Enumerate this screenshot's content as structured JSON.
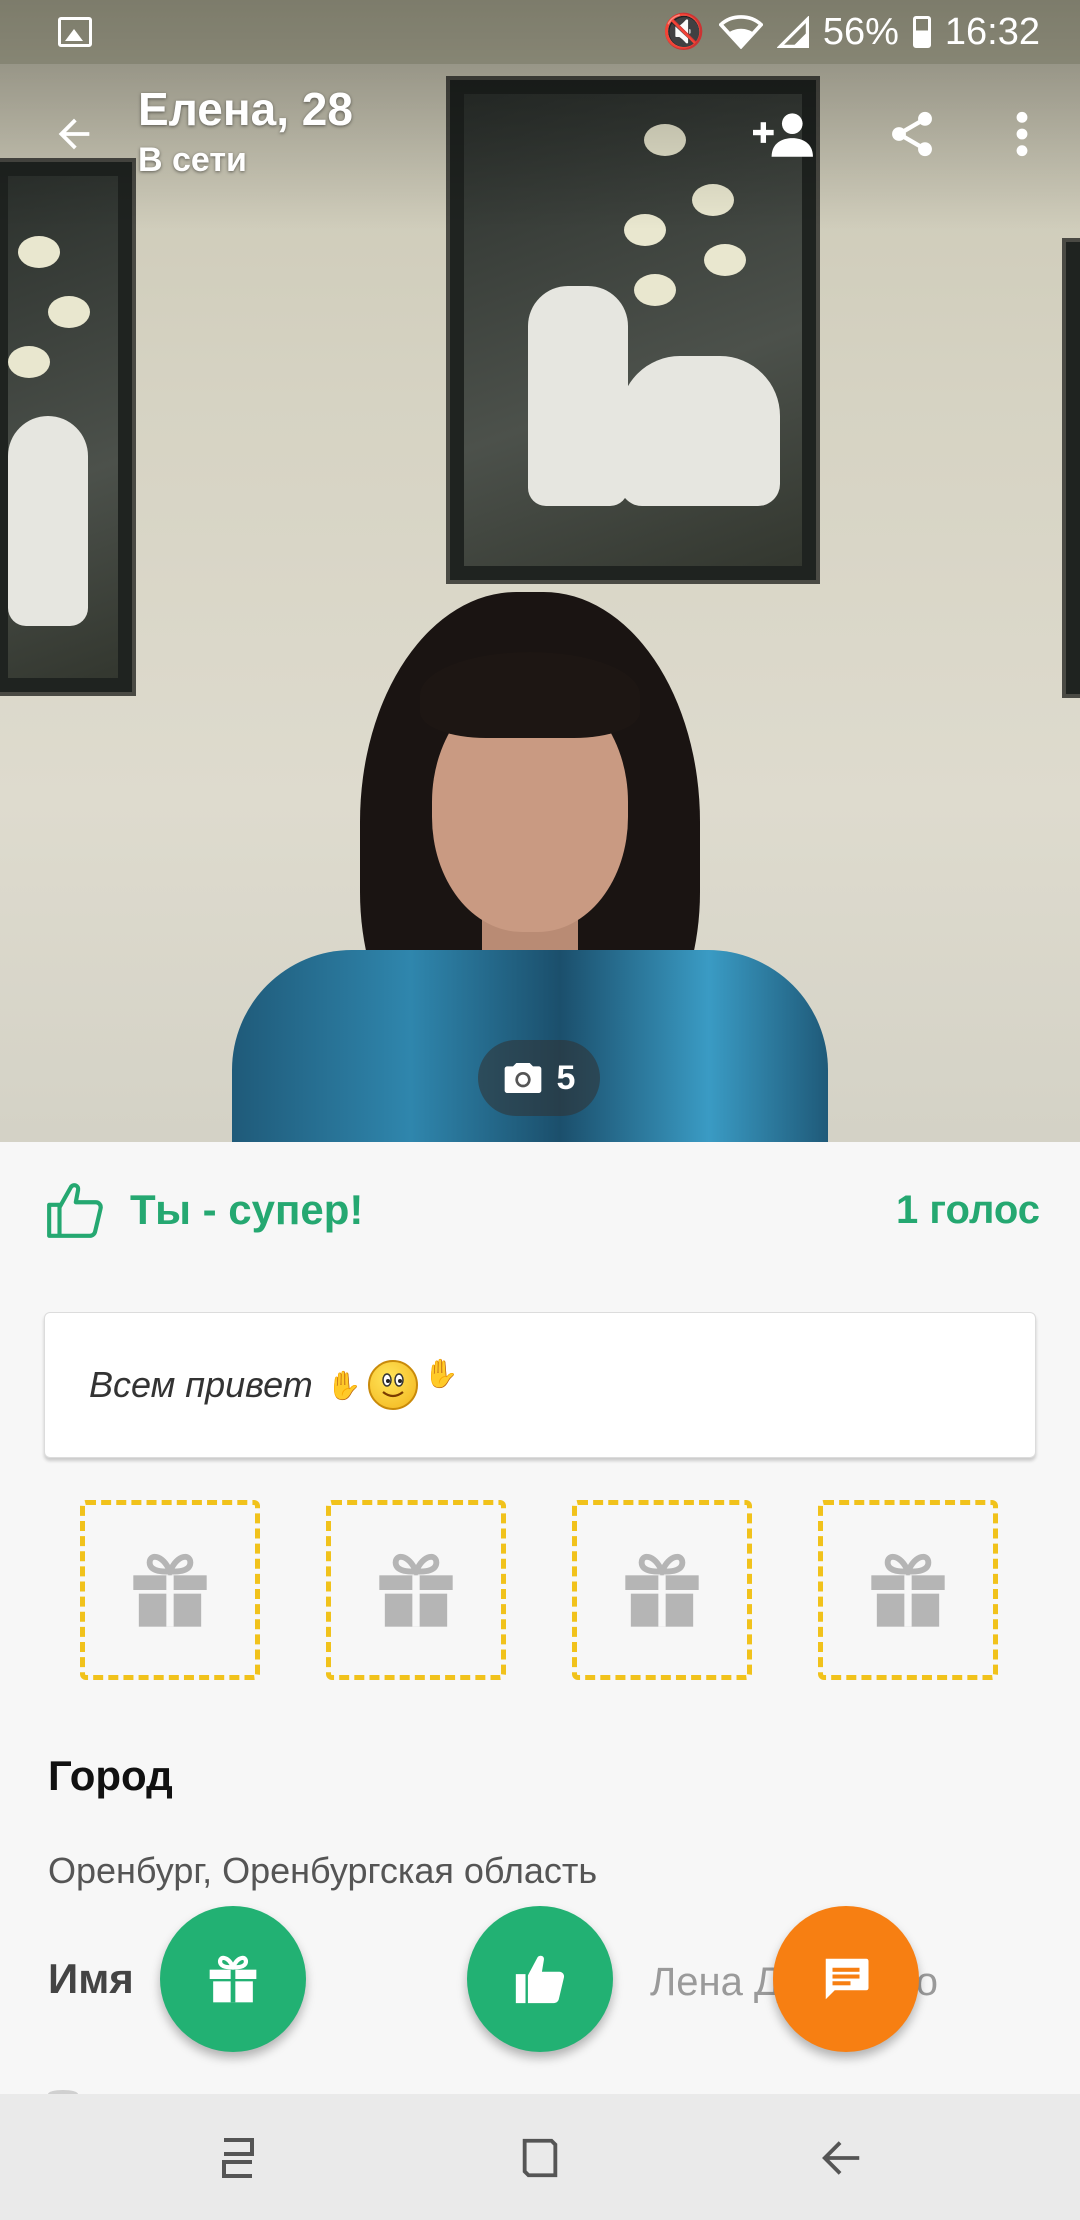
{
  "status_bar": {
    "battery": "56%",
    "time": "16:32"
  },
  "profile": {
    "title": "Елена, 28",
    "status": "В сети",
    "photo_count": "5"
  },
  "votes": {
    "label": "Ты - супер!",
    "count": "1 голос"
  },
  "status_message": {
    "text": "Всем привет"
  },
  "gifts": {
    "slots": 4
  },
  "details": {
    "city_label": "Город",
    "city_value": "Оренбург, Оренбургская область",
    "name_label": "Имя",
    "name_value": "Лена Дорменко"
  },
  "colors": {
    "accent_green": "#25a871",
    "fab_green": "#22b173",
    "fab_orange": "#f77f12",
    "gift_border": "#f1c21b"
  },
  "icons": {
    "back": "arrow-left-icon",
    "add_friend": "person-add-icon",
    "share": "share-icon",
    "more": "more-vertical-icon",
    "camera": "camera-icon",
    "like": "thumbs-up-icon",
    "gift": "gift-icon",
    "chat": "chat-icon"
  }
}
